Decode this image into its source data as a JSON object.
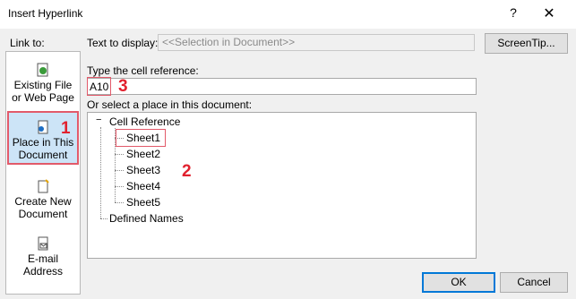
{
  "window": {
    "title": "Insert Hyperlink",
    "help_glyph": "?",
    "close_glyph": "✕"
  },
  "link_to": {
    "label": "Link to:",
    "items": [
      {
        "label": "Existing File or Web Page",
        "icon": "globe-document-icon"
      },
      {
        "label": "Place in This Document",
        "icon": "document-place-icon",
        "selected": true
      },
      {
        "label": "Create New Document",
        "icon": "new-document-icon"
      },
      {
        "label": "E-mail Address",
        "icon": "email-icon"
      }
    ]
  },
  "text_to_display": {
    "label": "Text to display:",
    "value": "<<Selection in Document>>"
  },
  "screentip_label": "ScreenTip...",
  "cell_reference": {
    "label": "Type the cell reference:",
    "value": "A10"
  },
  "place_select": {
    "label": "Or select a place in this document:",
    "tree": {
      "root": "Cell Reference",
      "collapse_glyph": "−",
      "sheets": [
        "Sheet1",
        "Sheet2",
        "Sheet3",
        "Sheet4",
        "Sheet5"
      ],
      "defined_names": "Defined Names"
    }
  },
  "annotations": [
    "1",
    "2",
    "3"
  ],
  "buttons": {
    "ok": "OK",
    "cancel": "Cancel"
  },
  "colors": {
    "selection_bg": "#cce4f7",
    "annotation_red": "#e1212e",
    "accent": "#0078d7"
  }
}
